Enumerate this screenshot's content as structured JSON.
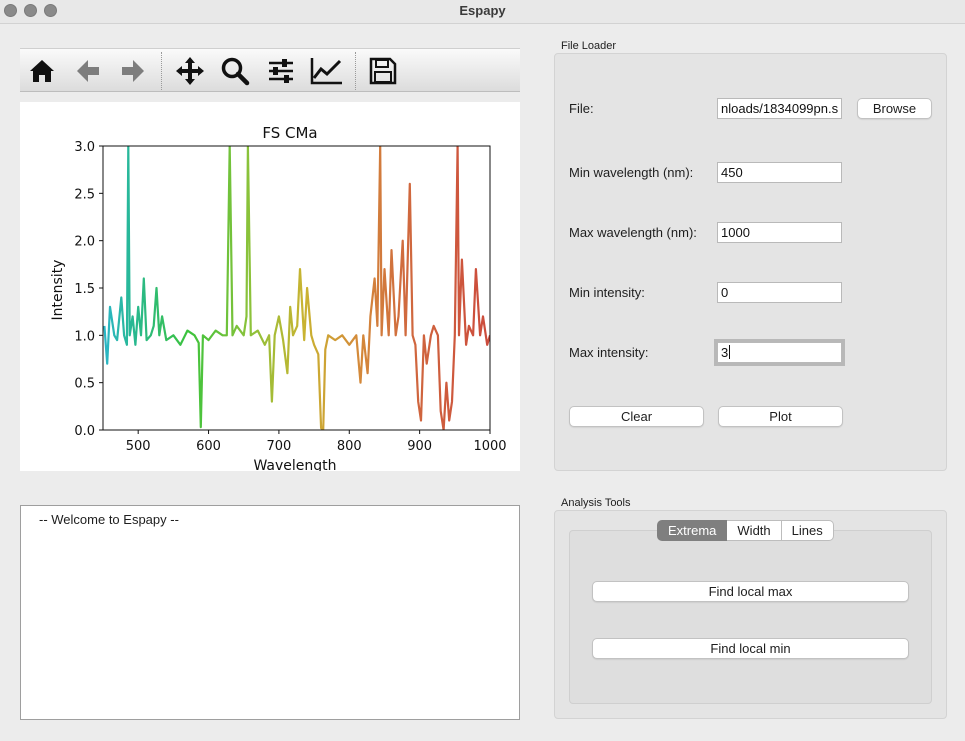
{
  "window": {
    "title": "Espapy"
  },
  "toolbar": {
    "icons": [
      "home-icon",
      "back-arrow-icon",
      "forward-arrow-icon",
      "pan-icon",
      "zoom-icon",
      "configure-subplots-icon",
      "edit-axes-icon",
      "save-icon"
    ]
  },
  "chart_data": {
    "type": "line",
    "title": "FS CMa",
    "xlabel": "Wavelength",
    "ylabel": "Intensity",
    "xlim": [
      450,
      1000
    ],
    "ylim": [
      0,
      3.0
    ],
    "xticks": [
      "500",
      "600",
      "700",
      "800",
      "900",
      "1000"
    ],
    "yticks": [
      "0.0",
      "0.5",
      "1.0",
      "1.5",
      "2.0",
      "2.5",
      "3.0"
    ],
    "colormap": "rainbow gradient by wavelength (teal → green → yellow → orange → red)",
    "x": [
      452,
      456,
      460,
      466,
      470,
      476,
      480,
      484,
      486,
      488,
      492,
      496,
      500,
      504,
      508,
      512,
      518,
      522,
      526,
      530,
      534,
      540,
      550,
      560,
      570,
      580,
      586,
      589,
      592,
      600,
      610,
      620,
      626,
      630,
      634,
      640,
      650,
      654,
      656,
      660,
      670,
      680,
      686,
      690,
      694,
      700,
      706,
      712,
      716,
      720,
      726,
      730,
      736,
      740,
      746,
      750,
      756,
      760,
      763,
      766,
      770,
      780,
      790,
      800,
      810,
      816,
      820,
      826,
      830,
      836,
      840,
      844,
      846,
      850,
      856,
      860,
      866,
      870,
      876,
      880,
      886,
      890,
      894,
      898,
      902,
      906,
      910,
      916,
      920,
      926,
      930,
      934,
      938,
      942,
      946,
      950,
      954,
      956,
      960,
      966,
      970,
      976,
      980,
      986,
      990,
      996,
      1000
    ],
    "y": [
      1.1,
      0.7,
      1.3,
      1.0,
      0.95,
      1.4,
      1.0,
      0.9,
      3.0,
      1.0,
      1.2,
      0.9,
      1.3,
      1.0,
      1.6,
      0.95,
      1.0,
      1.1,
      1.5,
      1.0,
      1.2,
      0.95,
      1.0,
      0.9,
      1.05,
      1.0,
      0.92,
      0.03,
      1.0,
      0.95,
      1.05,
      1.0,
      1.0,
      3.0,
      1.0,
      1.1,
      1.0,
      1.2,
      3.0,
      1.0,
      1.05,
      0.9,
      1.0,
      0.3,
      1.0,
      1.2,
      0.95,
      0.6,
      1.3,
      1.0,
      1.1,
      1.7,
      0.95,
      1.5,
      1.0,
      0.9,
      0.8,
      0.02,
      0.0,
      0.85,
      1.0,
      0.95,
      1.0,
      0.9,
      1.0,
      0.5,
      1.0,
      0.6,
      1.2,
      1.6,
      1.1,
      3.0,
      1.0,
      1.7,
      1.0,
      1.9,
      1.0,
      1.2,
      2.0,
      1.0,
      2.6,
      1.0,
      0.9,
      0.3,
      0.1,
      1.0,
      0.7,
      1.0,
      1.1,
      1.0,
      0.2,
      0.0,
      0.5,
      0.1,
      0.3,
      1.0,
      3.0,
      1.0,
      1.8,
      0.9,
      1.1,
      1.0,
      1.7,
      1.0,
      1.2,
      0.9,
      1.0
    ]
  },
  "console": {
    "text": "-- Welcome to Espapy --"
  },
  "file_loader": {
    "title": "File Loader",
    "file_label": "File:",
    "file_value": "nloads/1834099pn.s",
    "browse_label": "Browse",
    "min_wavelength_label": "Min wavelength (nm):",
    "min_wavelength_value": "450",
    "max_wavelength_label": "Max wavelength (nm):",
    "max_wavelength_value": "1000",
    "min_intensity_label": "Min intensity:",
    "min_intensity_value": "0",
    "max_intensity_label": "Max intensity:",
    "max_intensity_value": "3",
    "clear_label": "Clear",
    "plot_label": "Plot"
  },
  "analysis_tools": {
    "title": "Analysis Tools",
    "tabs": [
      {
        "label": "Extrema",
        "active": true
      },
      {
        "label": "Width",
        "active": false
      },
      {
        "label": "Lines",
        "active": false
      }
    ],
    "find_max_label": "Find local max",
    "find_min_label": "Find local min"
  },
  "colors": {
    "active_tab": "#7f7f7f",
    "window_bg": "#ececec",
    "groupbox_bg": "#e4e4e4"
  }
}
